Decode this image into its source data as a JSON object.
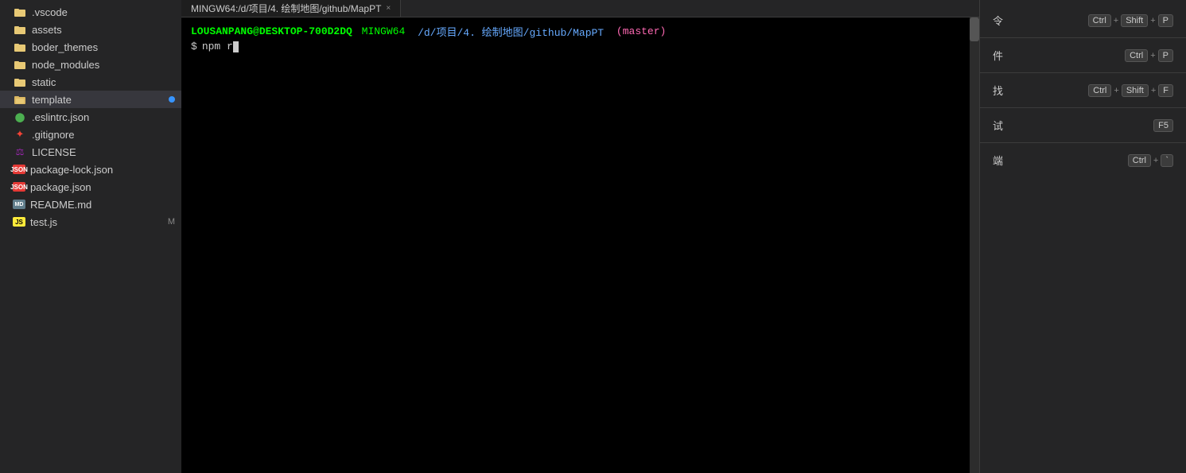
{
  "sidebar": {
    "items": [
      {
        "id": "vscode",
        "label": ".vscode",
        "icon": "folder",
        "iconType": "vscode",
        "indent": 0
      },
      {
        "id": "assets",
        "label": "assets",
        "icon": "folder",
        "iconType": "assets",
        "indent": 0
      },
      {
        "id": "boder_themes",
        "label": "boder_themes",
        "icon": "folder",
        "iconType": "boder",
        "indent": 0
      },
      {
        "id": "node_modules",
        "label": "node_modules",
        "icon": "folder",
        "iconType": "node",
        "indent": 0
      },
      {
        "id": "static",
        "label": "static",
        "icon": "folder",
        "iconType": "static",
        "indent": 0
      },
      {
        "id": "template",
        "label": "template",
        "icon": "folder-open",
        "iconType": "template",
        "indent": 0,
        "active": true,
        "hasDot": true
      },
      {
        "id": "eslintrc",
        "label": ".eslintrc.json",
        "icon": "eslint",
        "iconType": "eslint",
        "indent": 0
      },
      {
        "id": "gitignore",
        "label": ".gitignore",
        "icon": "git",
        "iconType": "gitignore",
        "indent": 0
      },
      {
        "id": "license",
        "label": "LICENSE",
        "icon": "license",
        "iconType": "license",
        "indent": 0
      },
      {
        "id": "package-lock",
        "label": "package-lock.json",
        "icon": "pkg-lock",
        "iconType": "package-lock",
        "indent": 0
      },
      {
        "id": "package",
        "label": "package.json",
        "icon": "pkg",
        "iconType": "package",
        "indent": 0
      },
      {
        "id": "readme",
        "label": "README.md",
        "icon": "readme",
        "iconType": "readme",
        "indent": 0
      },
      {
        "id": "testjs",
        "label": "test.js",
        "icon": "js",
        "iconType": "testjs",
        "indent": 0,
        "badge": "M"
      }
    ]
  },
  "terminal": {
    "tab_label": "MINGW64:/d/项目/4. 绘制地图/github/MapPT",
    "prompt_user": "LOUSANPANG@DESKTOP-700D2DQ",
    "prompt_mingw": "MINGW64",
    "prompt_path": "/d/项目/4. 绘制地图/github/MapPT",
    "prompt_branch": "(master)",
    "prompt_dollar": "$",
    "prompt_cmd": "npm r"
  },
  "right_panel": {
    "items": [
      {
        "id": "cmd1",
        "label": "令",
        "keys": [
          "Ctrl",
          "+",
          "Shift",
          "+",
          "P"
        ]
      },
      {
        "id": "cmd2",
        "label": "件",
        "keys": [
          "Ctrl",
          "+",
          "P"
        ]
      },
      {
        "id": "cmd3",
        "label": "找",
        "keys": [
          "Ctrl",
          "+",
          "Shift",
          "+",
          "F"
        ]
      },
      {
        "id": "cmd4",
        "label": "试",
        "keys": [
          "F5"
        ]
      },
      {
        "id": "cmd5",
        "label": "端",
        "keys": [
          "Ctrl",
          "+",
          "`"
        ]
      }
    ]
  },
  "icons": {
    "folder": "📁",
    "folder_open": "📂",
    "chevron_right": "›",
    "chevron_down": "⌄",
    "close": "×"
  }
}
